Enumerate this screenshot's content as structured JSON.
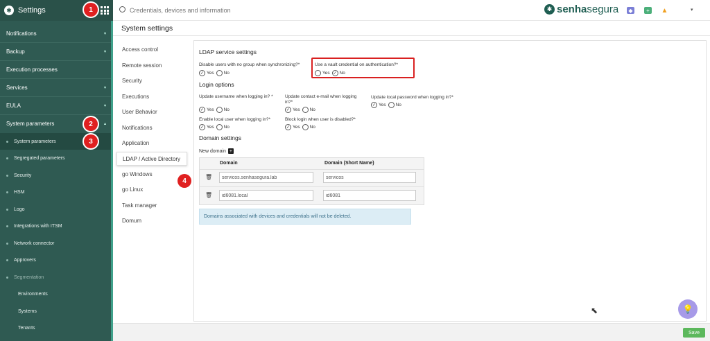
{
  "app": {
    "title": "Settings",
    "logo_glyph": "✱"
  },
  "colors": {
    "sidebar": "#2f5a52",
    "accent": "#3fa08a",
    "badge": "#e02020",
    "save": "#5cb85c"
  },
  "badges": [
    "1",
    "2",
    "3",
    "4"
  ],
  "sidebar": {
    "items": [
      {
        "label": "Notifications",
        "caret": "▾"
      },
      {
        "label": "Backup",
        "caret": "▾"
      },
      {
        "label": "Execution processes",
        "caret": ""
      },
      {
        "label": "Services",
        "caret": "▾"
      },
      {
        "label": "EULA",
        "caret": "▾"
      },
      {
        "label": "System parameters",
        "caret": "▴"
      }
    ],
    "subitems": [
      {
        "label": "System parameters"
      },
      {
        "label": "Segregated parameters"
      },
      {
        "label": "Security"
      },
      {
        "label": "HSM"
      },
      {
        "label": "Logo"
      },
      {
        "label": "Integrations with ITSM"
      },
      {
        "label": "Network connector"
      },
      {
        "label": "Approvers"
      },
      {
        "label": "Segmentation"
      }
    ],
    "subsubitems": [
      {
        "label": "Environments"
      },
      {
        "label": "Systems"
      },
      {
        "label": "Tenants"
      }
    ]
  },
  "topbar": {
    "search_placeholder": "Credentials, devices and information",
    "brand_bold": "senha",
    "brand_light": "segura",
    "icons": [
      "shield-icon",
      "plus-square-icon",
      "warning-icon"
    ]
  },
  "page": {
    "title": "System settings"
  },
  "leftnav": [
    "Access control",
    "Remote session",
    "Security",
    "Executions",
    "User Behavior",
    "Notifications",
    "Application",
    "LDAP / Active Directory",
    "go Windows",
    "go Linux",
    "Task manager",
    "Domum"
  ],
  "ldap": {
    "section_title": "LDAP service settings",
    "q_disable_users": "Disable users with no group when synchronizing?*",
    "q_vault_credential": "Use a vault credential on authentication?*",
    "login_title": "Login options",
    "q_update_username": "Update username when logging in? *",
    "q_update_email": "Update contact e-mail when logging in?*",
    "q_update_password": "Update local password when logging in?*",
    "q_enable_local": "Enable local user when logging in?*",
    "q_block_login": "Block login when user is disabled?*",
    "yes": "Yes",
    "no": "No",
    "domain_title": "Domain settings",
    "new_domain": "New domain",
    "col_domain": "Domain",
    "col_short": "Domain (Short Name)",
    "rows": [
      {
        "domain": "servicos.senhasegura.lab",
        "short": "servicos"
      },
      {
        "domain": "id6081.local",
        "short": "id6081"
      }
    ],
    "info": "Domains associated with devices and credentials will not be deleted."
  },
  "footer": {
    "save_label": "Save"
  }
}
